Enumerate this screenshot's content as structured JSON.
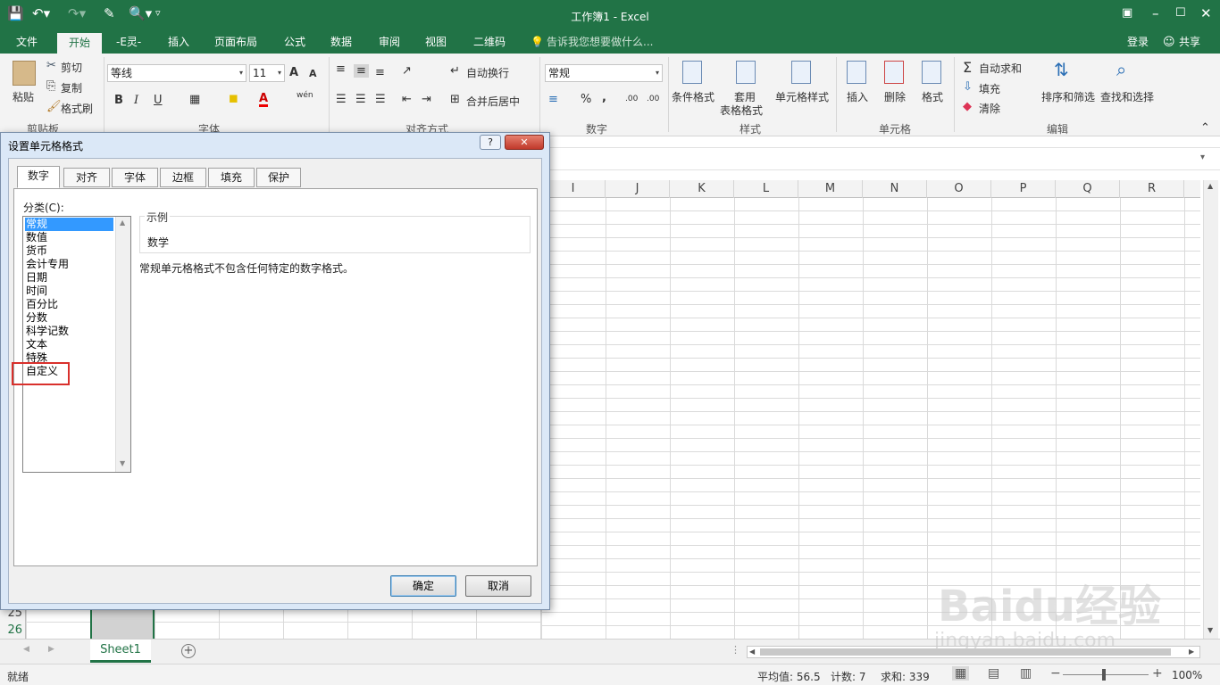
{
  "window": {
    "title": "工作簿1 - Excel"
  },
  "menu": {
    "items": [
      "文件",
      "开始",
      "-E灵-",
      "插入",
      "页面布局",
      "公式",
      "数据",
      "审阅",
      "视图",
      "二维码"
    ],
    "tell_me": "告诉我您想要做什么...",
    "login": "登录",
    "share": "共享"
  },
  "ribbon": {
    "clipboard": {
      "paste": "粘贴",
      "cut": "剪切",
      "copy": "复制",
      "format_painter": "格式刷",
      "group": "剪贴板"
    },
    "font": {
      "name": "等线",
      "size": "11",
      "group": "字体",
      "grow": "A",
      "shrink": "A",
      "bold": "B",
      "italic": "I",
      "underline": "U",
      "color_a": "A",
      "phonetic": "wén"
    },
    "alignment": {
      "wrap": "自动换行",
      "merge": "合并后居中",
      "group": "对齐方式"
    },
    "number": {
      "format": "常规",
      "percent": "%",
      "comma": ",",
      "inc": ".00",
      "dec": ".00",
      "group": "数字"
    },
    "styles": {
      "cond": "条件格式",
      "table_1": "套用",
      "table_2": "表格格式",
      "cell_styles": "单元格样式",
      "group": "样式"
    },
    "cells": {
      "insert": "插入",
      "delete": "删除",
      "format": "格式",
      "group": "单元格"
    },
    "editing": {
      "autosum": "自动求和",
      "fill": "填充",
      "clear": "清除",
      "sort": "排序和筛选",
      "find": "查找和选择",
      "group": "编辑"
    }
  },
  "grid": {
    "columns": [
      "I",
      "J",
      "K",
      "L",
      "M",
      "N",
      "O",
      "P",
      "Q",
      "R"
    ],
    "rows": [
      "25",
      "26"
    ]
  },
  "sheet": {
    "tab": "Sheet1",
    "add": "+"
  },
  "status": {
    "ready": "就绪",
    "avg": "平均值: 56.5",
    "count": "计数: 7",
    "sum": "求和: 339",
    "zoom": "100%"
  },
  "dialog": {
    "title": "设置单元格格式",
    "help": "?",
    "close": "✕",
    "tabs": [
      "数字",
      "对齐",
      "字体",
      "边框",
      "填充",
      "保护"
    ],
    "category_label": "分类(C):",
    "categories": [
      "常规",
      "数值",
      "货币",
      "会计专用",
      "日期",
      "时间",
      "百分比",
      "分数",
      "科学记数",
      "文本",
      "特殊",
      "自定义"
    ],
    "sample_label": "示例",
    "sample_value": "数学",
    "description": "常规单元格格式不包含任何特定的数字格式。",
    "ok": "确定",
    "cancel": "取消"
  },
  "watermark": {
    "brand": "Baidu经验",
    "url": "jingyan.baidu.com"
  },
  "colors": {
    "accent": "#217346",
    "highlight_box": "#d9302c",
    "selection": "#3399ff"
  }
}
